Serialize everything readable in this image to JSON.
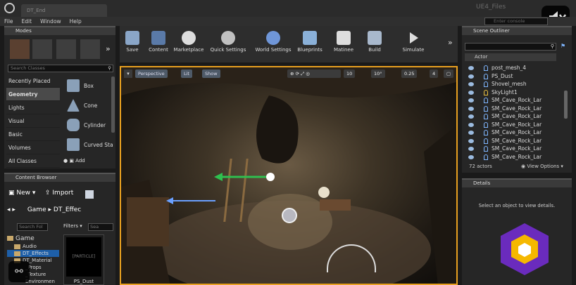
{
  "window": {
    "tab_title": "DT_End",
    "project_name": "UE4_Files"
  },
  "menu": [
    "File",
    "Edit",
    "Window",
    "Help"
  ],
  "modes": {
    "title": "Modes",
    "search_placeholder": "Search Classes",
    "categories": [
      "Recently Placed",
      "Geometry",
      "Lights",
      "Visual",
      "Basic",
      "Volumes",
      "All Classes"
    ],
    "selected_category": "Geometry",
    "items": [
      "Box",
      "Cone",
      "Cylinder",
      "Curved Sta"
    ],
    "add_label": "Add"
  },
  "toolbar": {
    "buttons": [
      "Save",
      "Content",
      "Marketplace",
      "Quick Settings",
      "World Settings",
      "Blueprints",
      "Matinee",
      "Build",
      "Simulate"
    ],
    "search_placeholder": "Enter console command"
  },
  "viewport": {
    "perspective": "Perspective",
    "lit": "Lit",
    "show": "Show",
    "grid_snap": "10",
    "rot_snap": "10°",
    "scale_snap": "0.25",
    "cam_speed": "4"
  },
  "content_browser": {
    "title": "Content Browser",
    "new_label": "New",
    "import_label": "Import",
    "path": [
      "Game",
      "DT_Effec"
    ],
    "folder_search": "Search Fol",
    "filters_label": "Filters",
    "search_short": "Sea",
    "tree": [
      "Game",
      "Audio",
      "DT_Effects",
      "DT_Material",
      "_Props",
      "_Texture",
      "Environmen"
    ],
    "selected_folder": "DT_Effects",
    "asset_name": "PS_Dust",
    "asset_thumb_label": "[PARTICLE]"
  },
  "outliner": {
    "title": "Scene Outliner",
    "column": "Actor",
    "items": [
      "post_mesh_4",
      "PS_Dust",
      "Shovel_mesh",
      "SkyLight1",
      "SM_Cave_Rock_Lar",
      "SM_Cave_Rock_Lar",
      "SM_Cave_Rock_Lar",
      "SM_Cave_Rock_Lar",
      "SM_Cave_Rock_Lar",
      "SM_Cave_Rock_Lar",
      "SM_Cave_Rock_Lar",
      "SM_Cave_Rock_Lar"
    ],
    "count": "72 actors",
    "view_options": "View Options"
  },
  "details": {
    "title": "Details",
    "empty_message": "Select an object to view details."
  },
  "colors": {
    "accent_blue": "#1e5fa8",
    "viewport_border": "#e8a020",
    "logo_purple": "#6a2bbd",
    "logo_yellow": "#f5b800"
  }
}
